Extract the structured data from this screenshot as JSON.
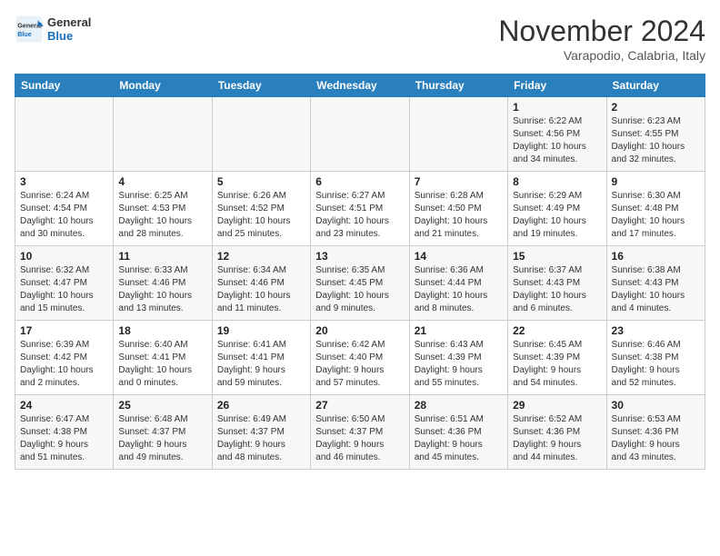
{
  "header": {
    "logo_line1": "General",
    "logo_line2": "Blue",
    "month": "November 2024",
    "location": "Varapodio, Calabria, Italy"
  },
  "weekdays": [
    "Sunday",
    "Monday",
    "Tuesday",
    "Wednesday",
    "Thursday",
    "Friday",
    "Saturday"
  ],
  "weeks": [
    [
      {
        "day": "",
        "info": ""
      },
      {
        "day": "",
        "info": ""
      },
      {
        "day": "",
        "info": ""
      },
      {
        "day": "",
        "info": ""
      },
      {
        "day": "",
        "info": ""
      },
      {
        "day": "1",
        "info": "Sunrise: 6:22 AM\nSunset: 4:56 PM\nDaylight: 10 hours\nand 34 minutes."
      },
      {
        "day": "2",
        "info": "Sunrise: 6:23 AM\nSunset: 4:55 PM\nDaylight: 10 hours\nand 32 minutes."
      }
    ],
    [
      {
        "day": "3",
        "info": "Sunrise: 6:24 AM\nSunset: 4:54 PM\nDaylight: 10 hours\nand 30 minutes."
      },
      {
        "day": "4",
        "info": "Sunrise: 6:25 AM\nSunset: 4:53 PM\nDaylight: 10 hours\nand 28 minutes."
      },
      {
        "day": "5",
        "info": "Sunrise: 6:26 AM\nSunset: 4:52 PM\nDaylight: 10 hours\nand 25 minutes."
      },
      {
        "day": "6",
        "info": "Sunrise: 6:27 AM\nSunset: 4:51 PM\nDaylight: 10 hours\nand 23 minutes."
      },
      {
        "day": "7",
        "info": "Sunrise: 6:28 AM\nSunset: 4:50 PM\nDaylight: 10 hours\nand 21 minutes."
      },
      {
        "day": "8",
        "info": "Sunrise: 6:29 AM\nSunset: 4:49 PM\nDaylight: 10 hours\nand 19 minutes."
      },
      {
        "day": "9",
        "info": "Sunrise: 6:30 AM\nSunset: 4:48 PM\nDaylight: 10 hours\nand 17 minutes."
      }
    ],
    [
      {
        "day": "10",
        "info": "Sunrise: 6:32 AM\nSunset: 4:47 PM\nDaylight: 10 hours\nand 15 minutes."
      },
      {
        "day": "11",
        "info": "Sunrise: 6:33 AM\nSunset: 4:46 PM\nDaylight: 10 hours\nand 13 minutes."
      },
      {
        "day": "12",
        "info": "Sunrise: 6:34 AM\nSunset: 4:46 PM\nDaylight: 10 hours\nand 11 minutes."
      },
      {
        "day": "13",
        "info": "Sunrise: 6:35 AM\nSunset: 4:45 PM\nDaylight: 10 hours\nand 9 minutes."
      },
      {
        "day": "14",
        "info": "Sunrise: 6:36 AM\nSunset: 4:44 PM\nDaylight: 10 hours\nand 8 minutes."
      },
      {
        "day": "15",
        "info": "Sunrise: 6:37 AM\nSunset: 4:43 PM\nDaylight: 10 hours\nand 6 minutes."
      },
      {
        "day": "16",
        "info": "Sunrise: 6:38 AM\nSunset: 4:43 PM\nDaylight: 10 hours\nand 4 minutes."
      }
    ],
    [
      {
        "day": "17",
        "info": "Sunrise: 6:39 AM\nSunset: 4:42 PM\nDaylight: 10 hours\nand 2 minutes."
      },
      {
        "day": "18",
        "info": "Sunrise: 6:40 AM\nSunset: 4:41 PM\nDaylight: 10 hours\nand 0 minutes."
      },
      {
        "day": "19",
        "info": "Sunrise: 6:41 AM\nSunset: 4:41 PM\nDaylight: 9 hours\nand 59 minutes."
      },
      {
        "day": "20",
        "info": "Sunrise: 6:42 AM\nSunset: 4:40 PM\nDaylight: 9 hours\nand 57 minutes."
      },
      {
        "day": "21",
        "info": "Sunrise: 6:43 AM\nSunset: 4:39 PM\nDaylight: 9 hours\nand 55 minutes."
      },
      {
        "day": "22",
        "info": "Sunrise: 6:45 AM\nSunset: 4:39 PM\nDaylight: 9 hours\nand 54 minutes."
      },
      {
        "day": "23",
        "info": "Sunrise: 6:46 AM\nSunset: 4:38 PM\nDaylight: 9 hours\nand 52 minutes."
      }
    ],
    [
      {
        "day": "24",
        "info": "Sunrise: 6:47 AM\nSunset: 4:38 PM\nDaylight: 9 hours\nand 51 minutes."
      },
      {
        "day": "25",
        "info": "Sunrise: 6:48 AM\nSunset: 4:37 PM\nDaylight: 9 hours\nand 49 minutes."
      },
      {
        "day": "26",
        "info": "Sunrise: 6:49 AM\nSunset: 4:37 PM\nDaylight: 9 hours\nand 48 minutes."
      },
      {
        "day": "27",
        "info": "Sunrise: 6:50 AM\nSunset: 4:37 PM\nDaylight: 9 hours\nand 46 minutes."
      },
      {
        "day": "28",
        "info": "Sunrise: 6:51 AM\nSunset: 4:36 PM\nDaylight: 9 hours\nand 45 minutes."
      },
      {
        "day": "29",
        "info": "Sunrise: 6:52 AM\nSunset: 4:36 PM\nDaylight: 9 hours\nand 44 minutes."
      },
      {
        "day": "30",
        "info": "Sunrise: 6:53 AM\nSunset: 4:36 PM\nDaylight: 9 hours\nand 43 minutes."
      }
    ]
  ]
}
